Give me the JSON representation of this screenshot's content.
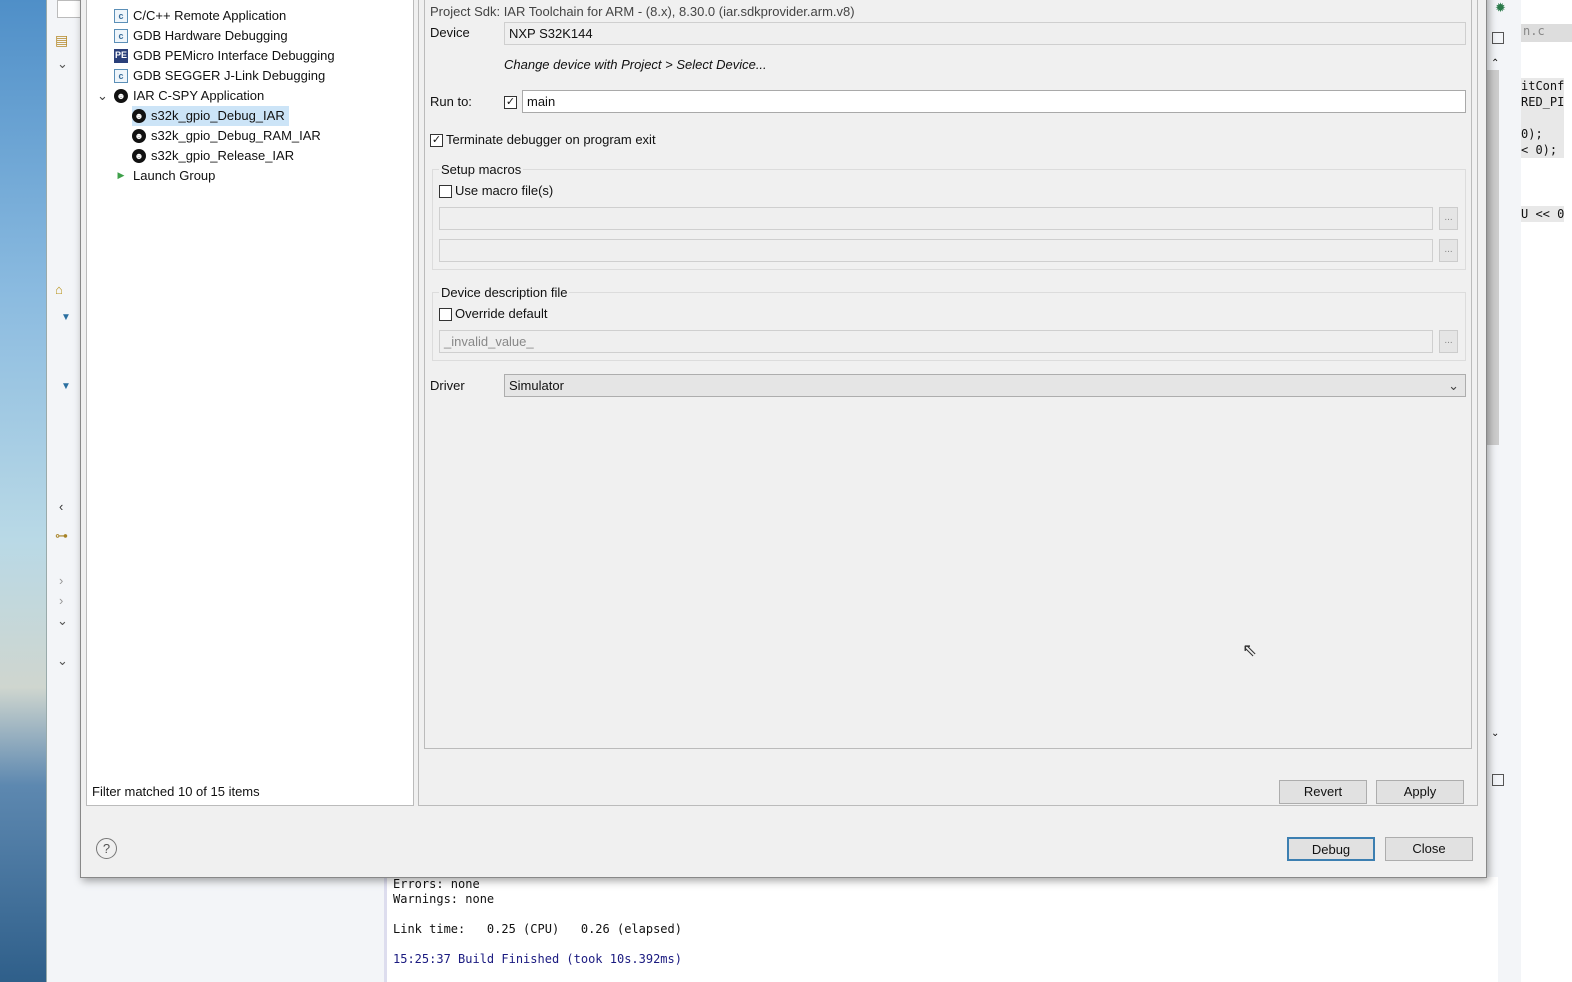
{
  "tree": {
    "items": [
      {
        "label": "C/C++ Remote Application",
        "icon": "c-app-icon"
      },
      {
        "label": "GDB Hardware Debugging",
        "icon": "c-app-icon"
      },
      {
        "label": "GDB PEMicro Interface Debugging",
        "icon": "pemicro-icon"
      },
      {
        "label": "GDB SEGGER J-Link Debugging",
        "icon": "c-app-icon"
      },
      {
        "label": "IAR C-SPY Application",
        "icon": "iar-icon"
      },
      {
        "label": "s32k_gpio_Debug_IAR",
        "icon": "iar-icon",
        "selected": true
      },
      {
        "label": "s32k_gpio_Debug_RAM_IAR",
        "icon": "iar-icon"
      },
      {
        "label": "s32k_gpio_Release_IAR",
        "icon": "iar-icon"
      },
      {
        "label": "Launch Group",
        "icon": "launch-group-icon"
      }
    ],
    "filter_status": "Filter matched 10 of 15 items"
  },
  "config": {
    "project_sdk": "Project Sdk: IAR Toolchain for ARM - (8.x), 8.30.0 (iar.sdkprovider.arm.v8)",
    "device_label": "Device",
    "device_value": "NXP S32K144",
    "device_hint": "Change device with Project > Select Device...",
    "run_to_label": "Run to:",
    "run_to_checked": true,
    "run_to_value": "main",
    "terminate_label": "Terminate debugger on program exit",
    "terminate_checked": true,
    "setup_macros_title": "Setup macros",
    "use_macro_label": "Use macro file(s)",
    "device_desc_title": "Device description file",
    "override_label": "Override default",
    "device_desc_value": "_invalid_value_",
    "browse_label": "...",
    "driver_label": "Driver",
    "driver_value": "Simulator"
  },
  "buttons": {
    "revert": "Revert",
    "apply": "Apply",
    "debug": "Debug",
    "close": "Close"
  },
  "console": {
    "lines": [
      "Errors: none",
      "Warnings: none",
      "",
      "Link time:   0.25 (CPU)   0.26 (elapsed)",
      "",
      "15:25:37 Build Finished (took 10s.392ms)"
    ]
  },
  "editor": {
    "tab": "n.c",
    "code": [
      "itConf",
      "RED_PI",
      "",
      "0);",
      "< 0);",
      "",
      "",
      "",
      "U << 0"
    ]
  }
}
